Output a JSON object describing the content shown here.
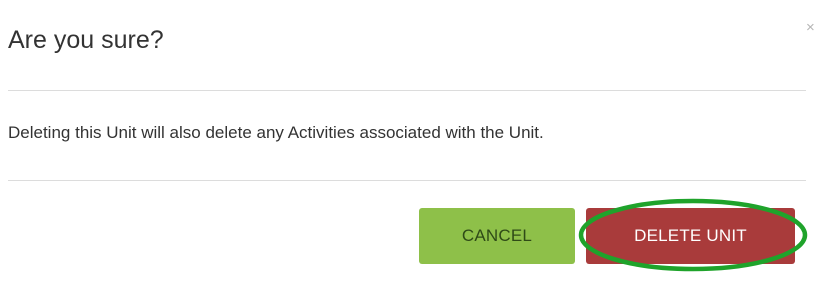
{
  "dialog": {
    "title": "Are you sure?",
    "close_glyph": "×",
    "message": "Deleting this Unit will also delete any Activities associated with the Unit.",
    "cancel_label": "CANCEL",
    "delete_label": "DELETE UNIT"
  },
  "icons": {
    "close": "close-icon"
  },
  "colors": {
    "cancel_button": "#8ec049",
    "delete_button": "#a93b3b",
    "highlight_ring": "#1fa32b",
    "divider": "#dcdcdc"
  }
}
